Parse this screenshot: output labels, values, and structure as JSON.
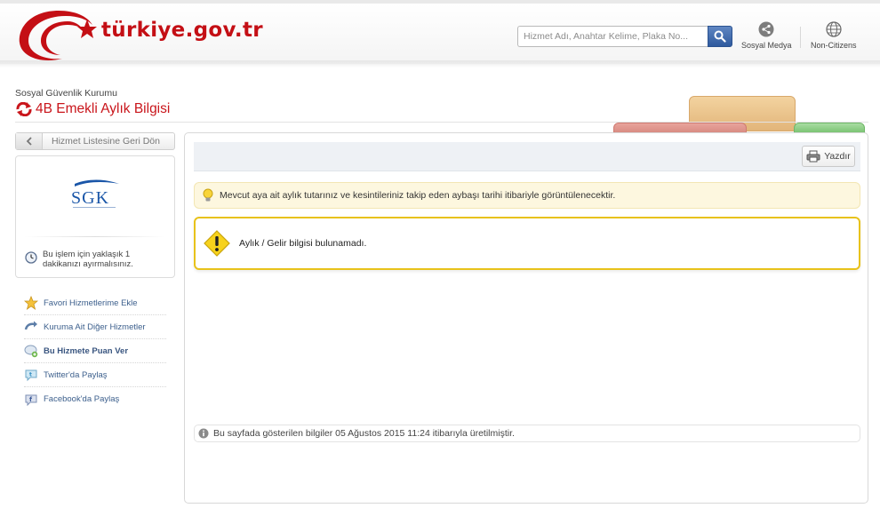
{
  "header": {
    "logo_text": "türkiye.gov.tr",
    "search_placeholder": "Hizmet Adı, Anahtar Kelime, Plaka No...",
    "social_label": "Sosyal Medya",
    "noncitizens_label": "Non-Citizens"
  },
  "page": {
    "organization": "Sosyal Güvenlik Kurumu",
    "service_title": "4B Emekli Aylık Bilgisi"
  },
  "sidebar": {
    "back_label": "Hizmet Listesine Geri Dön",
    "institution_logo_text": "SGK",
    "duration_text": "Bu işlem için yaklaşık 1 dakikanızı ayırmalısınız.",
    "actions": [
      {
        "label": "Favori Hizmetlerime Ekle",
        "icon": "star-icon"
      },
      {
        "label": "Kuruma Ait Diğer Hizmetler",
        "icon": "arrow-icon"
      },
      {
        "label": "Bu Hizmete Puan Ver",
        "icon": "rating-icon"
      },
      {
        "label": "Twitter'da Paylaş",
        "icon": "twitter-icon"
      },
      {
        "label": "Facebook'da Paylaş",
        "icon": "facebook-icon"
      }
    ]
  },
  "main": {
    "print_label": "Yazdır",
    "info_note": "Mevcut aya ait aylık tutarınız ve kesintileriniz takip eden aybaşı tarihi itibariyle görüntülenecektir.",
    "alert_message": "Aylık / Gelir bilgisi bulunamadı.",
    "generated_note": "Bu sayfada gösterilen bilgiler 05 Ağustos 2015 11:24 itibarıyla üretilmiştir."
  },
  "colors": {
    "brand_red": "#c40f15",
    "link_blue": "#3c5f8c",
    "alert_border": "#e8c21a",
    "note_bg": "#fdf7df"
  }
}
